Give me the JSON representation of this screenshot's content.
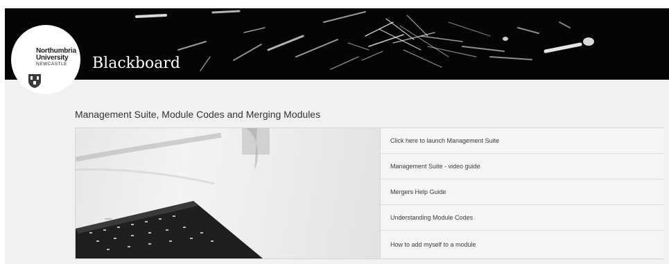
{
  "brand": {
    "university_line1": "Northumbria",
    "university_line2": "University",
    "university_line3": "NEWCASTLE",
    "app_title": "Blackboard"
  },
  "section": {
    "title": "Management Suite, Module Codes and Merging Modules"
  },
  "links": [
    {
      "label": "Click here to launch Management Suite"
    },
    {
      "label": "Management Suite - video guide"
    },
    {
      "label": "Mergers Help Guide"
    },
    {
      "label": "Understanding Module Codes"
    },
    {
      "label": "How to add myself to a module"
    }
  ],
  "images": {
    "banner": "sparks-banner-image",
    "module": "laptop-keyboard-photo"
  }
}
